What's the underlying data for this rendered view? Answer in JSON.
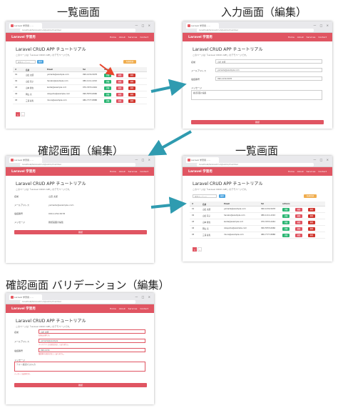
{
  "captions": {
    "list": "一覧画面",
    "input": "入力画面（編集）",
    "confirm": "確認画面（編集）",
    "list2": "一覧画面",
    "validation": "確認画面 バリデーション（編集）"
  },
  "browser": {
    "tab_title": "Laravel 学習用 - ...",
    "address": "localhost/laravelcrud/public/member",
    "window_controls": "— □ ×"
  },
  "app": {
    "brand": "Laravel 学習用",
    "nav": [
      "Home",
      "About",
      "Services",
      "Contact"
    ],
    "title": "Laravel CRUD APP チュートリアル",
    "subtitle": "このページは「Laravel CRUD APP」のデモページです。"
  },
  "list": {
    "search_placeholder": "検索キーワード",
    "search_button": "検索",
    "new_button": "新規登録",
    "headers": [
      "#",
      "名前",
      "Email",
      "Tel",
      "actions"
    ],
    "rows": [
      [
        "01",
        "山田 太郎",
        "yamada@example.com",
        "090-1234-5678"
      ],
      [
        "02",
        "山田 花子",
        "hanako@example.com",
        "080-1111-2222"
      ],
      [
        "03",
        "山本 健太",
        "kenta@example.com",
        "070-3333-4444"
      ],
      [
        "04",
        "岡山 亮",
        "okayama@example.com",
        "090-5555-6666"
      ],
      [
        "05",
        "三浦 春馬",
        "miura@example.com",
        "080-7777-8888"
      ]
    ],
    "action_labels": [
      "詳細",
      "編集",
      "削除"
    ],
    "pages": [
      "1",
      "»"
    ]
  },
  "form": {
    "labels": [
      "名前",
      "メールアドレス",
      "電話番号",
      "メッセージ"
    ],
    "values": [
      "山田 太郎",
      "yamada@example.com",
      "090-1234-5678",
      "確認画面の編集"
    ],
    "submit": "確認"
  },
  "validation": {
    "values": [
      "山田 太郎",
      "yamada@example",
      "090-1234",
      "テスト 確認からの入力"
    ],
    "errors": [
      "名前は必須です。",
      "メールアドレスの形式が正しくありません。",
      "電話番号の形式が正しくありません。",
      "メッセージは必須です。"
    ]
  },
  "colors": {
    "brand": "#e05562",
    "arrow": "#2f9bb0",
    "red_marker": "#e8452c"
  }
}
